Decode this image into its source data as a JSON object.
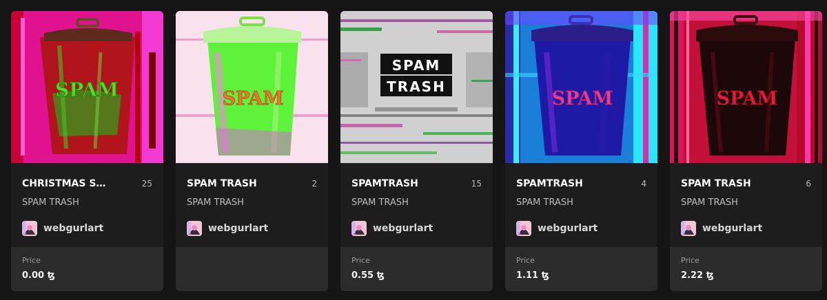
{
  "price_label": "Price",
  "cards": [
    {
      "title": "CHRISTMAS S…",
      "edition": "25",
      "collection": "SPAM TRASH",
      "creator": "webgurlart",
      "price": "0.00 ꜩ",
      "art_text": "SPAM",
      "art_theme": "magenta-red-green"
    },
    {
      "title": "SPAM TRASH",
      "edition": "2",
      "collection": "SPAM TRASH",
      "creator": "webgurlart",
      "price": "",
      "art_text": "SPAM",
      "art_theme": "pink-lime"
    },
    {
      "title": "SPAMTRASH",
      "edition": "15",
      "collection": "SPAM TRASH",
      "creator": "webgurlart",
      "price": "0.55 ꜩ",
      "art_text": "SPAM TRASH",
      "art_theme": "glitch-noise"
    },
    {
      "title": "SPAMTRASH",
      "edition": "4",
      "collection": "SPAM TRASH",
      "creator": "webgurlart",
      "price": "1.11 ꜩ",
      "art_text": "SPAM",
      "art_theme": "blue-cyan"
    },
    {
      "title": "SPAM TRASH",
      "edition": "6",
      "collection": "SPAM TRASH",
      "creator": "webgurlart",
      "price": "2.22 ꜩ",
      "art_text": "SPAM",
      "art_theme": "red-black"
    }
  ]
}
